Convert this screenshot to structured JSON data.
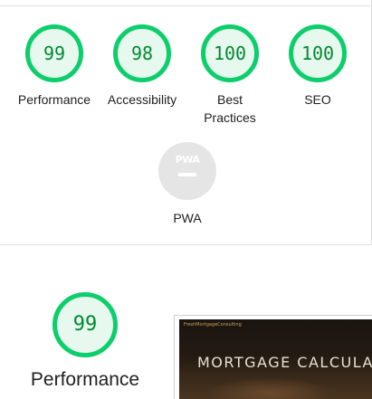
{
  "categories": [
    {
      "label": "Performance",
      "score": "99"
    },
    {
      "label": "Accessibility",
      "score": "98"
    },
    {
      "label": "Best Practices",
      "score": "100"
    },
    {
      "label": "SEO",
      "score": "100"
    }
  ],
  "pwa": {
    "badge_text": "PWA",
    "label": "PWA"
  },
  "section": {
    "score": "99",
    "label": "Performance"
  },
  "screenshot": {
    "brand_text": "FreshMortgageConsulting",
    "title": "MORTGAGE CALCULATOR"
  },
  "colors": {
    "pass_ring": "#0cce6b",
    "pass_fill": "#e7f8ee",
    "pass_text": "#008a31",
    "na_gray": "#e5e5e5"
  },
  "icons": [
    "pwa-badge-icon"
  ]
}
